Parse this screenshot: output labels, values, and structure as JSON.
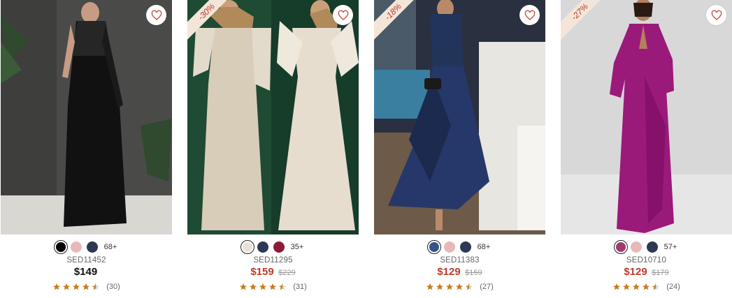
{
  "products": [
    {
      "sku": "SED11452",
      "price": "$149",
      "original_price": "",
      "on_sale": false,
      "discount": "",
      "colors": [
        "#000000",
        "#e8b8b8",
        "#2b3a52"
      ],
      "more_colors": "68+",
      "rating": 4.5,
      "reviews": "(30)"
    },
    {
      "sku": "SED11295",
      "price": "$159",
      "original_price": "$229",
      "on_sale": true,
      "discount": "-30%",
      "colors": [
        "#e9e1d8",
        "#2b3a52",
        "#8e1b33"
      ],
      "more_colors": "35+",
      "rating": 4.5,
      "reviews": "(31)"
    },
    {
      "sku": "SED11383",
      "price": "$129",
      "original_price": "$159",
      "on_sale": true,
      "discount": "-18%",
      "colors": [
        "#34548a",
        "#e8b8b8",
        "#2b3a52"
      ],
      "more_colors": "68+",
      "rating": 4.5,
      "reviews": "(27)"
    },
    {
      "sku": "SED10710",
      "price": "$129",
      "original_price": "$179",
      "on_sale": true,
      "discount": "-27%",
      "colors": [
        "#a23a6c",
        "#e8b8b8",
        "#2b3a52"
      ],
      "more_colors": "57+",
      "rating": 4.5,
      "reviews": "(24)"
    }
  ],
  "icons": {
    "wishlist": "heart-outline-icon",
    "star": "star-icon"
  },
  "theme": {
    "sale_color": "#c0392b",
    "star_color": "#c77b1e",
    "ribbon_bg": "#f3e6d8"
  }
}
